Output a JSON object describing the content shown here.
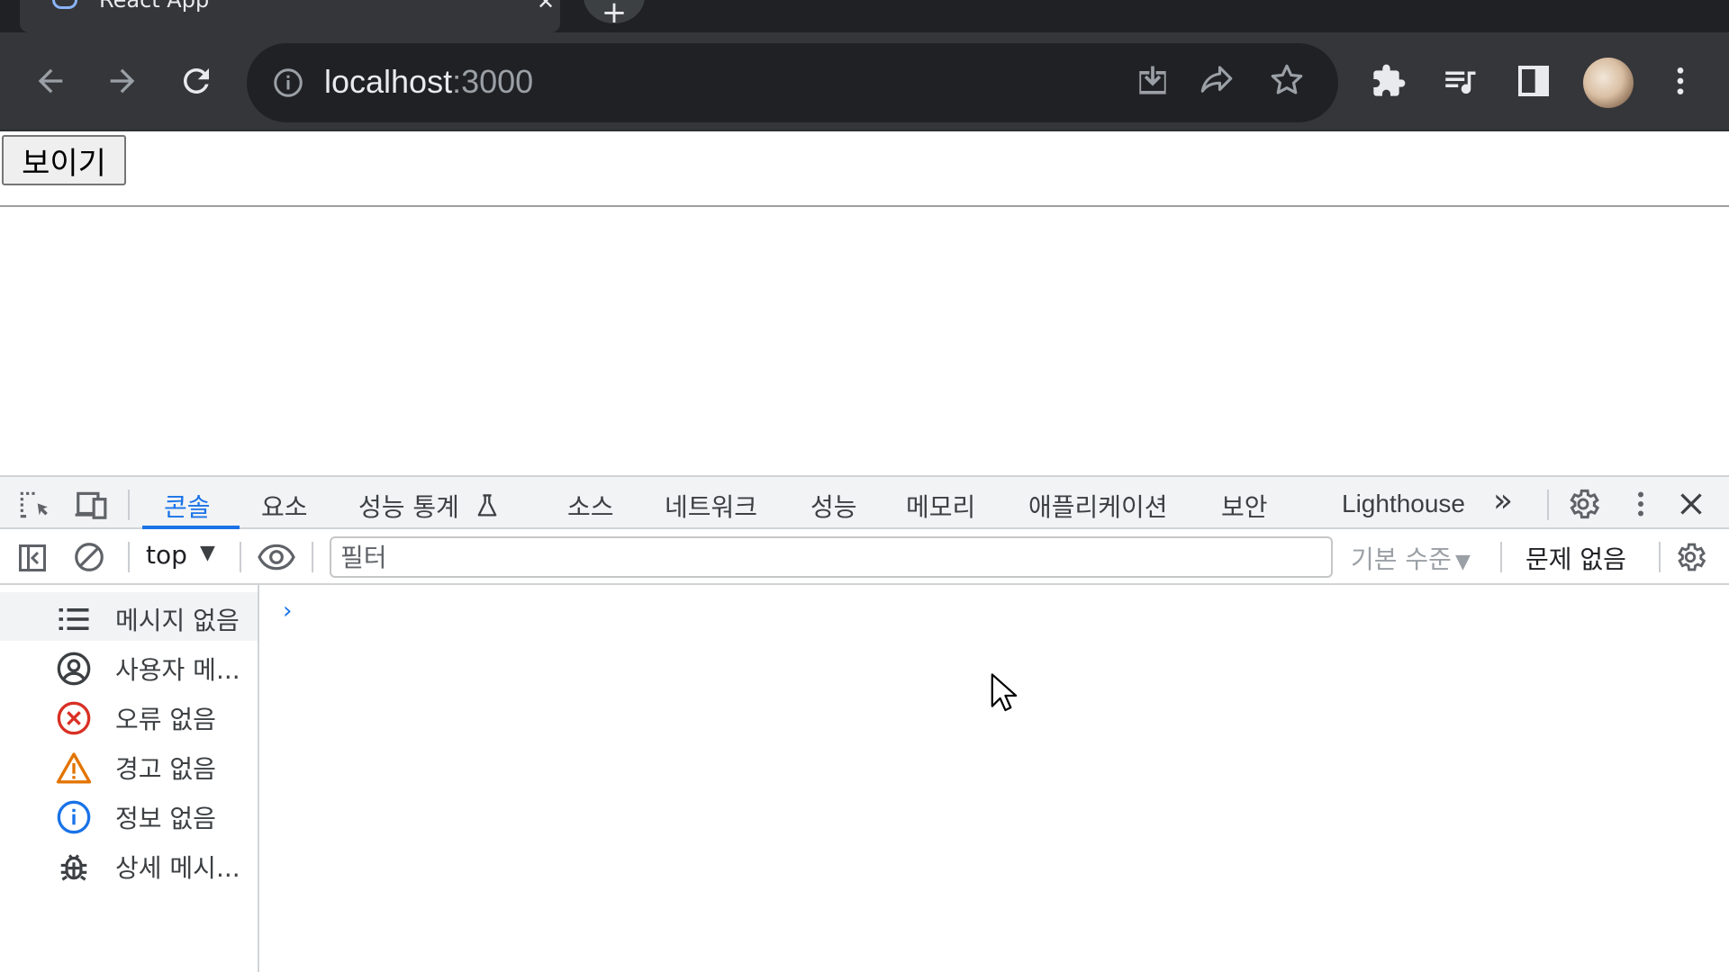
{
  "browser": {
    "tab_title": "React App",
    "url_host": "localhost",
    "url_port": ":3000"
  },
  "page": {
    "show_button_label": "보이기"
  },
  "devtools": {
    "tabs": [
      {
        "label": "콘솔",
        "active": true
      },
      {
        "label": "요소"
      },
      {
        "label": "성능 통계"
      },
      {
        "label": "소스"
      },
      {
        "label": "네트워크"
      },
      {
        "label": "성능"
      },
      {
        "label": "메모리"
      },
      {
        "label": "애플리케이션"
      },
      {
        "label": "보안"
      },
      {
        "label": "Lighthouse"
      }
    ],
    "more_tabs": "»",
    "console": {
      "context": "top",
      "filter_placeholder": "필터",
      "levels_label": "기본 수준",
      "issues_label": "문제 없음",
      "prompt": "›"
    },
    "sidebar": [
      {
        "label": "메시지 없음",
        "icon": "list-icon"
      },
      {
        "label": "사용자 메...",
        "icon": "user-icon"
      },
      {
        "label": "오류 없음",
        "icon": "error-icon"
      },
      {
        "label": "경고 없음",
        "icon": "warning-icon"
      },
      {
        "label": "정보 없음",
        "icon": "info-icon"
      },
      {
        "label": "상세 메시...",
        "icon": "bug-icon"
      }
    ]
  },
  "colors": {
    "accent": "#1a73e8",
    "error": "#d93025",
    "warning": "#e37400",
    "toolbar": "#35363a"
  }
}
